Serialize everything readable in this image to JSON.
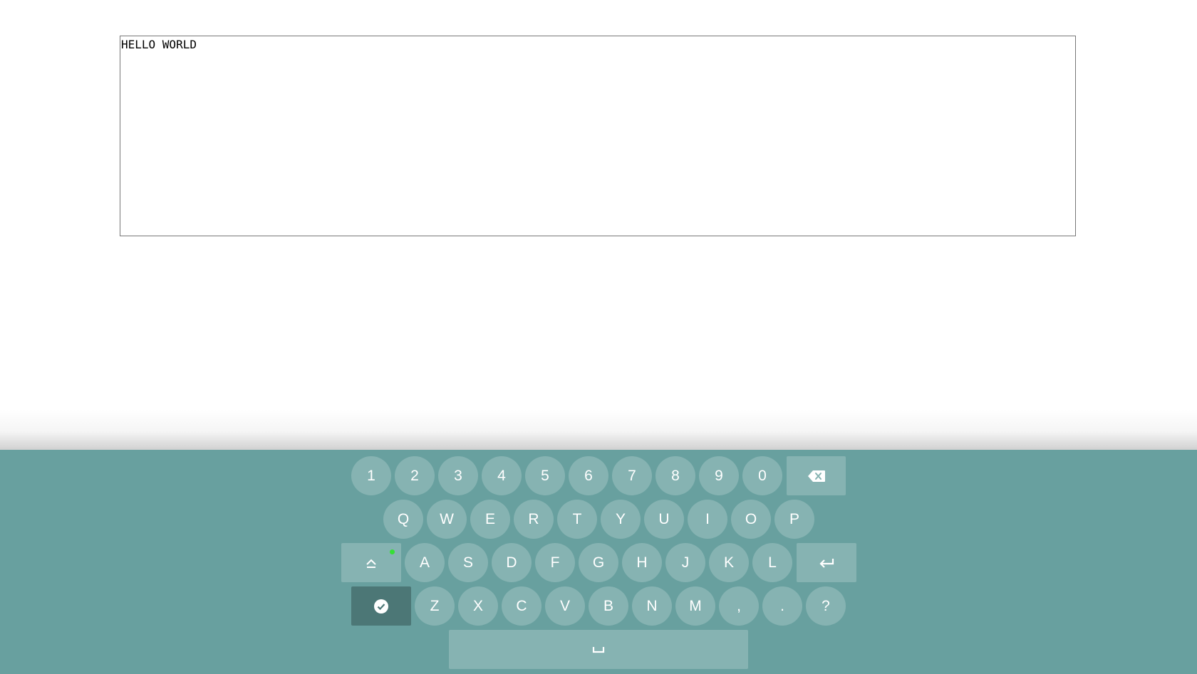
{
  "editor": {
    "text": "HELLO WORLD"
  },
  "keyboard": {
    "row1": [
      "1",
      "2",
      "3",
      "4",
      "5",
      "6",
      "7",
      "8",
      "9",
      "0"
    ],
    "row2": [
      "Q",
      "W",
      "E",
      "R",
      "T",
      "Y",
      "U",
      "I",
      "O",
      "P"
    ],
    "row3": [
      "A",
      "S",
      "D",
      "F",
      "G",
      "H",
      "J",
      "K",
      "L"
    ],
    "row4": [
      "Z",
      "X",
      "C",
      "V",
      "B",
      "N",
      "M",
      ",",
      ".",
      "?"
    ],
    "icons": {
      "backspace": "backspace-icon",
      "shift": "shift-icon",
      "enter": "enter-icon",
      "done": "checkmark-circle-icon",
      "space": "space-icon"
    },
    "shift_active": true,
    "colors": {
      "background": "#68a09f",
      "key": "#86b3b2",
      "done_key": "#4c7776",
      "shift_indicator": "#35e035"
    }
  }
}
